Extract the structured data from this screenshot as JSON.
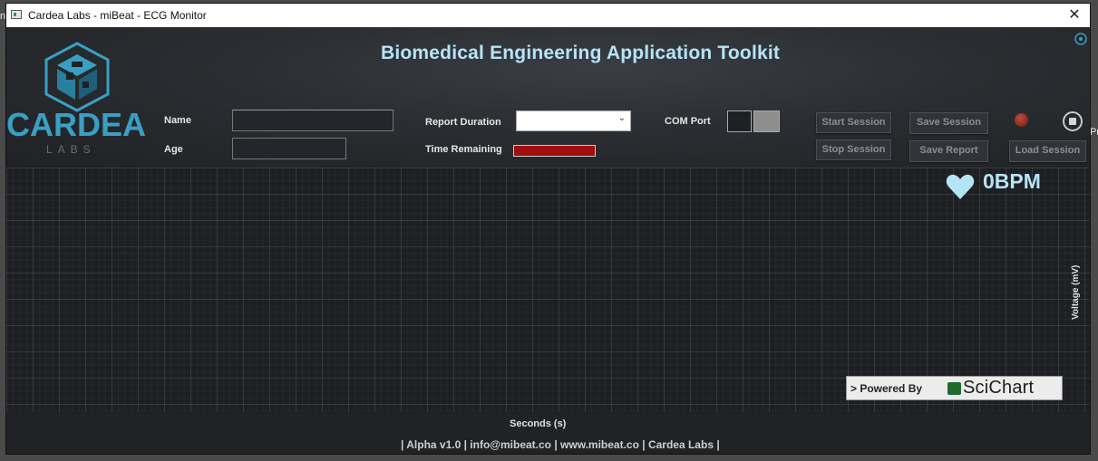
{
  "window": {
    "title": "Cardea Labs - miBeat - ECG Monitor",
    "close_glyph": "✕"
  },
  "logo": {
    "brand": "CARDEA",
    "sub": "LABS"
  },
  "header": {
    "app_title": "Biomedical Engineering Application Toolkit",
    "name_label": "Name",
    "name_value": "",
    "age_label": "Age",
    "age_value": "",
    "report_duration_label": "Report Duration",
    "report_duration_value": "",
    "time_remaining_label": "Time Remaining",
    "time_remaining_progress": 1.0,
    "com_port_label": "COM Port"
  },
  "buttons": {
    "start_session": "Start Session",
    "stop_session": "Stop Session",
    "save_session": "Save Session",
    "save_report": "Save Report",
    "load_session": "Load Session"
  },
  "status": {
    "led_color": "#a33326",
    "bpm": "0BPM"
  },
  "chart": {
    "ylabel": "Voltage (mV)",
    "xlabel": "Seconds (s)",
    "powered_by": "> Powered By",
    "brand": "SciChart"
  },
  "footer": {
    "credits": "| Alpha v1.0 | info@mibeat.co | www.mibeat.co | Cardea Labs |"
  },
  "colors": {
    "accent": "#b6e4f7",
    "logo": "#3a9fc4",
    "progress": "#a00e0e",
    "background": "#1f2124"
  },
  "icons": [
    "app-icon",
    "close-icon",
    "settings-icon",
    "stop-icon",
    "heart-icon",
    "scichart-icon",
    "dropdown-arrow-icon"
  ]
}
